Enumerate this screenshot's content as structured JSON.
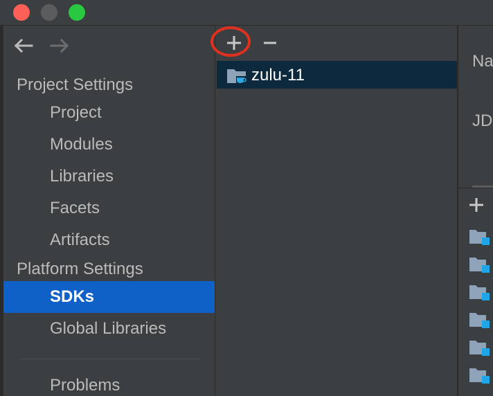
{
  "window": {
    "close": "close",
    "minimize": "minimize",
    "maximize": "maximize"
  },
  "navigation": {
    "back_icon": "arrow-left-icon",
    "forward_icon": "arrow-right-icon"
  },
  "sidebar": {
    "project_settings_heading": "Project Settings",
    "project_items": [
      "Project",
      "Modules",
      "Libraries",
      "Facets",
      "Artifacts"
    ],
    "platform_settings_heading": "Platform Settings",
    "platform_items": [
      "SDKs",
      "Global Libraries"
    ],
    "selected": "SDKs",
    "problems": "Problems"
  },
  "sdk_list": {
    "add_icon": "plus-icon",
    "remove_icon": "minus-icon",
    "items": [
      {
        "name": "zulu-11",
        "icon": "jdk-folder-icon"
      }
    ]
  },
  "detail": {
    "name_label_partial": "Na",
    "jdk_label_partial": "JD",
    "add_icon": "plus-icon",
    "classpath_entry_icon": "jar-folder-icon"
  },
  "colors": {
    "selection": "#0f60c7",
    "list_selection": "#0d293e",
    "annotation": "#e0301e"
  }
}
